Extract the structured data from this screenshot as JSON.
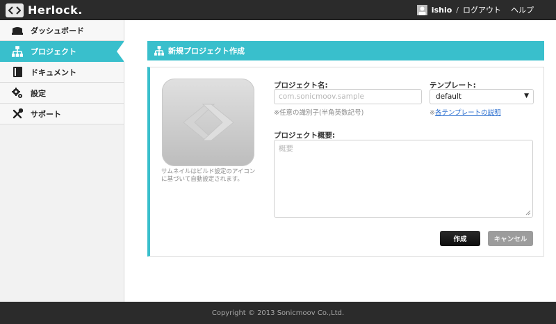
{
  "app": {
    "name": "Herlock."
  },
  "topnav": {
    "username": "ishio",
    "separator": "/",
    "logout": "ログアウト",
    "help": "ヘルプ"
  },
  "sidebar": {
    "items": [
      {
        "label": "ダッシュボード",
        "icon": "dashboard-icon",
        "active": false
      },
      {
        "label": "プロジェクト",
        "icon": "project-tree-icon",
        "active": true
      },
      {
        "label": "ドキュメント",
        "icon": "book-icon",
        "active": false
      },
      {
        "label": "設定",
        "icon": "gears-icon",
        "active": false
      },
      {
        "label": "サポート",
        "icon": "tools-icon",
        "active": false
      }
    ]
  },
  "panel": {
    "title": "新規プロジェクト作成"
  },
  "form": {
    "thumbnail_note": "サムネイルはビルド設定のアイコンに基づいて自動設定されます。",
    "project_name": {
      "label": "プロジェクト名:",
      "placeholder": "com.sonicmoov.sample",
      "hint": "※任意の識別子(半角英数記号)"
    },
    "template": {
      "label": "テンプレート:",
      "value": "default",
      "hint_prefix": "※",
      "hint_link": "各テンプレートの説明"
    },
    "summary": {
      "label": "プロジェクト概要:",
      "placeholder": "概要"
    },
    "create_button": "作成",
    "cancel_button": "キャンセル"
  },
  "footer": {
    "copyright": "Copyright © 2013 Sonicmoov Co.,Ltd."
  },
  "colors": {
    "accent": "#39bfcc",
    "topbar": "#2b2b2b",
    "primary_button": "#1a1a1a",
    "cancel_button": "#9c9c9c"
  }
}
